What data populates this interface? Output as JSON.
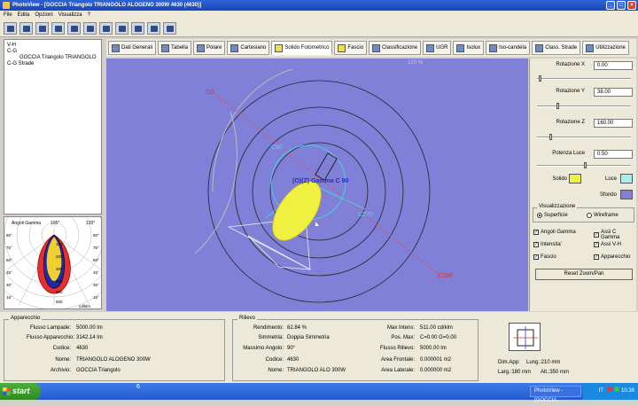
{
  "window": {
    "title": "PhotoView - [GOCCIA Triangolo TRIANGOLO ALOGENO 300W 4630 (4630)]"
  },
  "menu": [
    "File",
    "Edita",
    "Opzioni",
    "Visualizza",
    "?"
  ],
  "tree": [
    "V-H",
    "C-G",
    "GOCCIA Triangolo TRIANGOLO",
    "C-G Strade"
  ],
  "polar": {
    "title_left": "Angoli Gamma",
    "title_angle": "105°",
    "title_right": "120°",
    "unit": "cd/klm",
    "angles_left": [
      "90°",
      "75°",
      "60°",
      "45°",
      "30°",
      "15°"
    ],
    "angles_right": [
      "90°",
      "75°",
      "60°",
      "45°",
      "30°",
      "15°"
    ],
    "values": [
      "100",
      "200",
      "300",
      "400",
      "500",
      "600"
    ]
  },
  "tabs": [
    "Dati Generali",
    "Tabella",
    "Polare",
    "Cartesiano",
    "Solido Fotometrico",
    "Fascio",
    "Classificazione",
    "UGR",
    "Isolux",
    "Iso-candela",
    "Class. Strade",
    "Utilizzazione"
  ],
  "view": {
    "label_c0": "C0",
    "label_c90": "C90",
    "label_c180": "C180",
    "label_c270": "C270",
    "label_g": "(O)(Z) Gamma C 90",
    "label_top": "120 %"
  },
  "controls": {
    "rot_x_label": "Rotazione X",
    "rot_x": "0.00",
    "rot_y_label": "Rotazione Y",
    "rot_y": "38.00",
    "rot_z_label": "Rotazione Z",
    "rot_z": "160.00",
    "power_label": "Potenza Luce",
    "power": "0.50",
    "solido_label": "Solido",
    "luce_label": "Luce",
    "sfondo_label": "Sfondo",
    "colors": {
      "solido": "#f0f040",
      "luce": "#a8f0f0",
      "sfondo": "#8080d8"
    },
    "vis_title": "Visualizzazione",
    "superficie": "Superficie",
    "wireframe": "Wireframe",
    "angoli_gamma": "Angoli Gamma",
    "assi_c_gamma": "Assi C Gamma",
    "intensita": "Intensita'",
    "assi_vh": "Assi V-H",
    "fascio": "Fascio",
    "apparecchio": "Apparecchio",
    "reset": "Reset Zoom/Pan"
  },
  "apparecchio": {
    "title": "Apparecchio",
    "flusso_lampade_label": "Flusso Lampade:",
    "flusso_lampade": "5000.00 lm",
    "flusso_app_label": "Flusso Apparecchio:",
    "flusso_app": "3142.14 lm",
    "codice_label": "Codice:",
    "codice": "4630",
    "nome_label": "Nome:",
    "nome": "TRIANGOLO ALOGENO 300W",
    "archivio_label": "Archivio:",
    "archivio": "GOCCIA Triangolo"
  },
  "rilievo": {
    "title": "Rilievo",
    "rend_label": "Rendimento:",
    "rend": "62.84 %",
    "simm_label": "Simmetria:",
    "simm": "Doppia Simmetria",
    "max_ang_label": "Massimo Angolo:",
    "max_ang": "90°",
    "codice_label": "Codice:",
    "codice": "4630",
    "nome_label": "Nome:",
    "nome": "TRIANGOLO ALO 300W",
    "max_int_label": "Max Intens:",
    "max_int": "511.00 cd/klm",
    "pos_max_label": "Pos. Max:",
    "pos_max": "C=0.00 G=0.00",
    "flusso_ril_label": "Flusso Rilievo:",
    "flusso_ril": "5000.00 lm",
    "area_fr_label": "Area Frontale:",
    "area_fr": "0.000001 m2",
    "area_lat_label": "Area Laterale:",
    "area_lat": "0.000000 m2"
  },
  "dims": {
    "app_label": "Dim.App:",
    "lung": "Lung.:210 mm",
    "larg": "Larg.:180 mm",
    "alt": "Alt.:350 mm"
  },
  "status": {
    "page": "6"
  },
  "taskbar": {
    "start": "start",
    "task": "PhotoView - [GOCCIA...",
    "lang": "IT",
    "clock": "10.38"
  }
}
